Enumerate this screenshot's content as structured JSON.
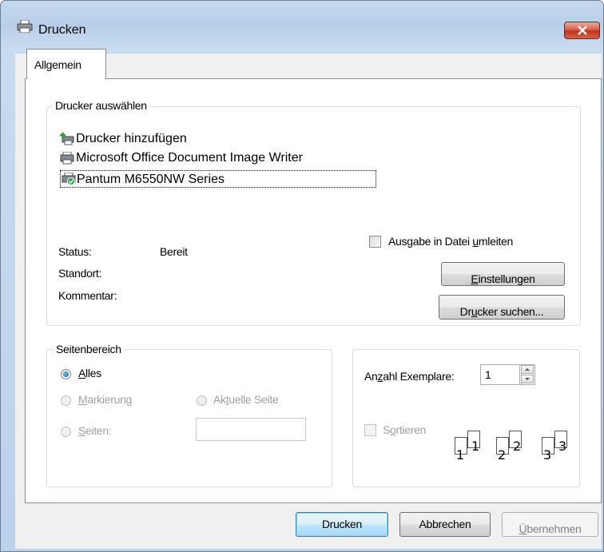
{
  "window": {
    "title": "Drucken"
  },
  "tabs": [
    {
      "label": "Allgemein"
    }
  ],
  "printer_group": {
    "label": "Drucker auswählen",
    "printers": [
      {
        "name": "Drucker hinzufügen",
        "icon": "add-printer-icon"
      },
      {
        "name": "Microsoft Office Document Image Writer",
        "icon": "printer-icon"
      },
      {
        "name": "Pantum M6550NW Series",
        "icon": "default-printer-icon",
        "selected": true
      }
    ],
    "status_label": "Status:",
    "status_value": "Bereit",
    "location_label": "Standort:",
    "location_value": "",
    "comment_label": "Kommentar:",
    "comment_value": "",
    "print_to_file": {
      "pre": "Ausgabe in Datei ",
      "accel": "u",
      "post": "mleiten",
      "checked": false
    },
    "settings_button": {
      "pre": "",
      "accel": "E",
      "post": "instellungen"
    },
    "find_printer_button": {
      "pre": "Dr",
      "accel": "u",
      "post": "cker suchen..."
    }
  },
  "page_range": {
    "label": "Seitenbereich",
    "all": {
      "pre": "",
      "accel": "A",
      "post": "lles",
      "checked": true
    },
    "selection": {
      "pre": "",
      "accel": "M",
      "post": "arkierung",
      "enabled": false
    },
    "current_page": {
      "pre": "Ak",
      "accel": "t",
      "post": "uelle Seite",
      "enabled": false
    },
    "pages": {
      "pre": "",
      "accel": "S",
      "post": "eiten:",
      "enabled": false,
      "value": ""
    }
  },
  "copies": {
    "label_pre": "An",
    "label_accel": "z",
    "label_post": "ahl Exemplare:",
    "value": "1",
    "collate": {
      "pre": "S",
      "accel": "o",
      "post": "rtieren",
      "checked": false,
      "enabled": false
    },
    "collate_pages": [
      "1",
      "1",
      "2",
      "2",
      "3",
      "3"
    ]
  },
  "footer": {
    "print_button": "Drucken",
    "cancel_button": "Abbrechen",
    "apply_button": {
      "pre": "",
      "accel": "Ü",
      "post": "bernehmen"
    }
  },
  "colors": {
    "window_frame": "#bcd1ea",
    "close_button": "#c7412a",
    "default_button": "#3c7fb1"
  }
}
